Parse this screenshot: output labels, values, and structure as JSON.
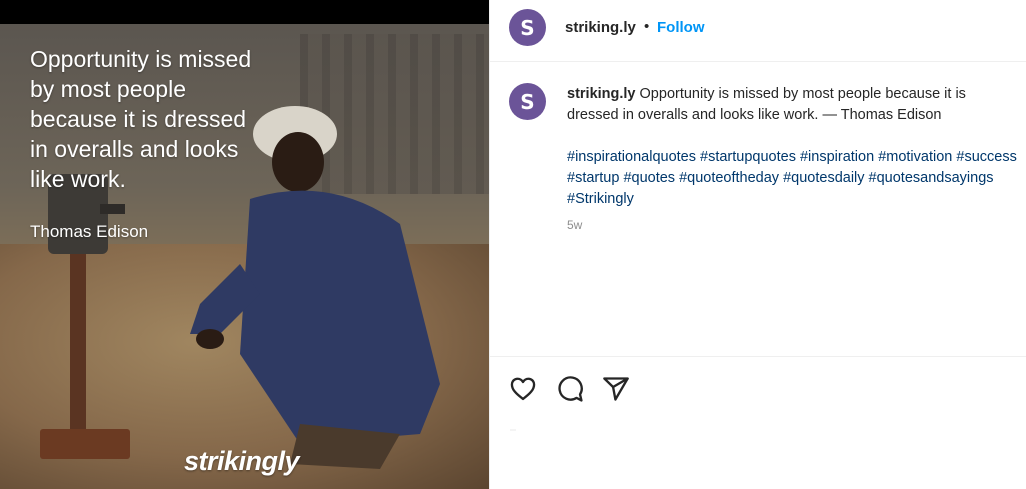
{
  "post_image": {
    "quote_lines": [
      "Opportunity is missed",
      "by most people",
      "because it is dressed",
      "in overalls and looks",
      "like work."
    ],
    "author": "Thomas Edison",
    "watermark": "strikingly"
  },
  "header": {
    "avatar_letter": "S",
    "username": "striking.ly",
    "separator": "•",
    "follow_label": "Follow"
  },
  "caption": {
    "avatar_letter": "S",
    "username": "striking.ly",
    "text": "Opportunity is missed by most people because it is dressed in overalls and looks like work. — Thomas Edison",
    "hashtags": [
      "#inspirationalquotes",
      "#startupquotes",
      "#inspiration",
      "#motivation",
      "#success",
      "#startup",
      "#quotes",
      "#quoteoftheday",
      "#quotesdaily",
      "#quotesandsayings",
      "#Strikingly"
    ],
    "age": "5w"
  },
  "actions": {
    "icons": [
      "heart-icon",
      "comment-icon",
      "share-icon"
    ]
  },
  "colors": {
    "avatar": "#6b5498",
    "follow": "#0095f6",
    "hashtag": "#00376b",
    "muted": "#8e8e8e"
  }
}
